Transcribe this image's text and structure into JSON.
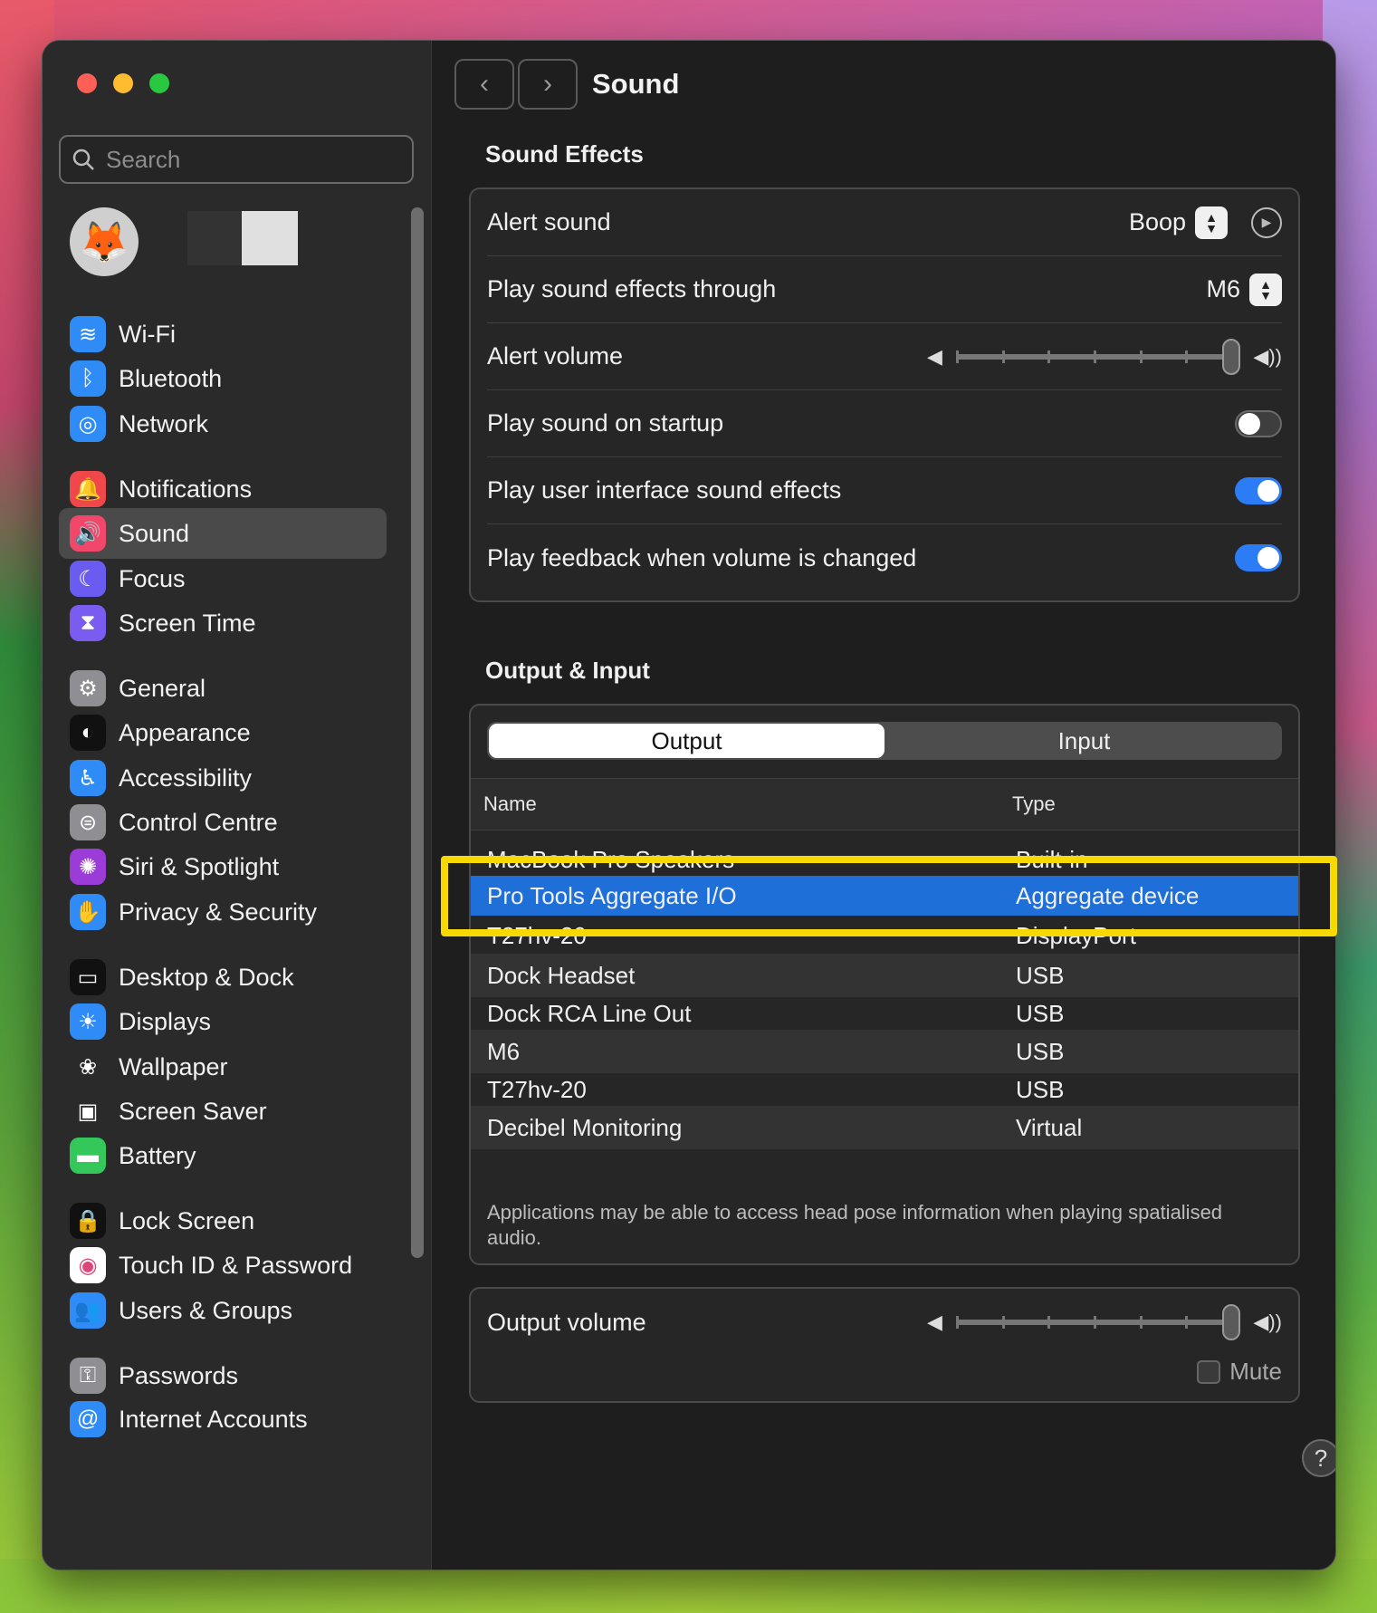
{
  "window": {
    "title": "Sound"
  },
  "sidebar": {
    "search_placeholder": "Search",
    "items": [
      {
        "label": "Wi-Fi",
        "icon": "wifi-icon",
        "color": "#2f8cf6",
        "glyph": "≋"
      },
      {
        "label": "Bluetooth",
        "icon": "bluetooth-icon",
        "color": "#2f8cf6",
        "glyph": "ᛒ"
      },
      {
        "label": "Network",
        "icon": "globe-icon",
        "color": "#2f8cf6",
        "glyph": "◎"
      },
      {
        "label": "Notifications",
        "icon": "bell-icon",
        "color": "#f0474a",
        "glyph": "🔔"
      },
      {
        "label": "Sound",
        "icon": "speaker-icon",
        "color": "#f0476a",
        "glyph": "🔊"
      },
      {
        "label": "Focus",
        "icon": "moon-icon",
        "color": "#6a5cf0",
        "glyph": "☾"
      },
      {
        "label": "Screen Time",
        "icon": "hourglass-icon",
        "color": "#7a5cf0",
        "glyph": "⧗"
      },
      {
        "label": "General",
        "icon": "gear-icon",
        "color": "#8e8e93",
        "glyph": "⚙"
      },
      {
        "label": "Appearance",
        "icon": "appearance-icon",
        "color": "#111111",
        "glyph": "◐"
      },
      {
        "label": "Accessibility",
        "icon": "accessibility-icon",
        "color": "#2f8cf6",
        "glyph": "♿"
      },
      {
        "label": "Control Centre",
        "icon": "control-centre-icon",
        "color": "#8e8e93",
        "glyph": "⊜"
      },
      {
        "label": "Siri & Spotlight",
        "icon": "siri-icon",
        "color": "#9b3cd8",
        "glyph": "✺"
      },
      {
        "label": "Privacy & Security",
        "icon": "hand-icon",
        "color": "#2f8cf6",
        "glyph": "✋"
      },
      {
        "label": "Desktop & Dock",
        "icon": "dock-icon",
        "color": "#111111",
        "glyph": "▭"
      },
      {
        "label": "Displays",
        "icon": "sun-icon",
        "color": "#2f8cf6",
        "glyph": "☀"
      },
      {
        "label": "Wallpaper",
        "icon": "flower-icon",
        "color": "#2a2a2a",
        "glyph": "❀"
      },
      {
        "label": "Screen Saver",
        "icon": "screensaver-icon",
        "color": "#2a2a2a",
        "glyph": "▣"
      },
      {
        "label": "Battery",
        "icon": "battery-icon",
        "color": "#34c759",
        "glyph": "▬"
      },
      {
        "label": "Lock Screen",
        "icon": "lock-icon",
        "color": "#111111",
        "glyph": "🔒"
      },
      {
        "label": "Touch ID & Password",
        "icon": "fingerprint-icon",
        "color": "#ffffff",
        "glyph": "◉"
      },
      {
        "label": "Users & Groups",
        "icon": "users-icon",
        "color": "#2f8cf6",
        "glyph": "👥"
      },
      {
        "label": "Passwords",
        "icon": "key-icon",
        "color": "#8e8e93",
        "glyph": "⚿"
      },
      {
        "label": "Internet Accounts",
        "icon": "at-icon",
        "color": "#2f8cf6",
        "glyph": "@"
      }
    ]
  },
  "sound_effects": {
    "section_title": "Sound Effects",
    "alert_sound_label": "Alert sound",
    "alert_sound_value": "Boop",
    "play_through_label": "Play sound effects through",
    "play_through_value": "M6",
    "alert_volume_label": "Alert volume",
    "alert_volume_level": 1.0,
    "startup_label": "Play sound on startup",
    "startup_on": false,
    "ui_sounds_label": "Play user interface sound effects",
    "ui_sounds_on": true,
    "feedback_label": "Play feedback when volume is changed",
    "feedback_on": true
  },
  "output_input": {
    "section_title": "Output & Input",
    "tabs": [
      "Output",
      "Input"
    ],
    "selected_tab": "Output",
    "columns": [
      "Name",
      "Type"
    ],
    "devices": [
      {
        "name": "MacBook Pro Speakers",
        "type": "Built-in"
      },
      {
        "name": "Pro Tools Aggregate I/O",
        "type": "Aggregate device",
        "selected": true
      },
      {
        "name": "T27hv-20",
        "type": "DisplayPort"
      },
      {
        "name": "Dock Headset",
        "type": "USB"
      },
      {
        "name": "Dock RCA Line Out",
        "type": "USB"
      },
      {
        "name": "M6",
        "type": "USB"
      },
      {
        "name": "T27hv-20",
        "type": "USB"
      },
      {
        "name": "Decibel Monitoring",
        "type": "Virtual"
      }
    ],
    "footnote": "Applications may be able to access head pose information when playing spatialised audio."
  },
  "output_volume": {
    "label": "Output volume",
    "level": 1.0,
    "mute_label": "Mute",
    "muted": false
  },
  "help": "?",
  "colors": {
    "accent": "#2c7cf6",
    "selection": "#1f6fd8",
    "highlight": "#f7d800"
  }
}
